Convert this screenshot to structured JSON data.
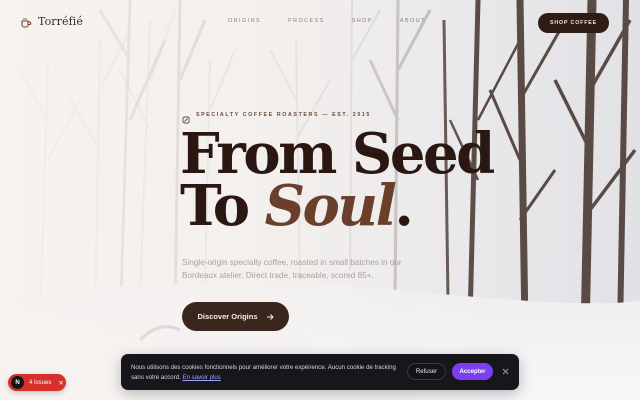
{
  "brand": {
    "name": "Torréfié",
    "icon": "coffee-cup-icon"
  },
  "nav": {
    "items": [
      "Origins",
      "Process",
      "Shop",
      "About"
    ]
  },
  "header": {
    "shop_label": "Shop Coffee"
  },
  "hero": {
    "eyebrow": "Specialty coffee roasters — Est. 2015",
    "title_line1": "From Seed",
    "title_line2_prefix": "To ",
    "title_line2_accent": "Soul",
    "title_line2_suffix": ".",
    "subtitle": "Single-origin specialty coffee, roasted in small batches in our Bordeaux atelier. Direct trade, traceable, scored 85+.",
    "cta_label": "Discover Origins"
  },
  "cookie": {
    "text": "Nous utilisons des cookies fonctionnels pour améliorer votre expérience. Aucun cookie de tracking sans votre accord.",
    "link": "En savoir plus",
    "refuse_label": "Refuser",
    "accept_label": "Accepter"
  },
  "issues": {
    "logo": "N",
    "label": "4 Issues"
  },
  "colors": {
    "accent_dark": "#2f1c15",
    "accent_brown": "#6a3f2c",
    "accept_purple": "#7b3ff2",
    "issues_red": "#d6302b"
  }
}
